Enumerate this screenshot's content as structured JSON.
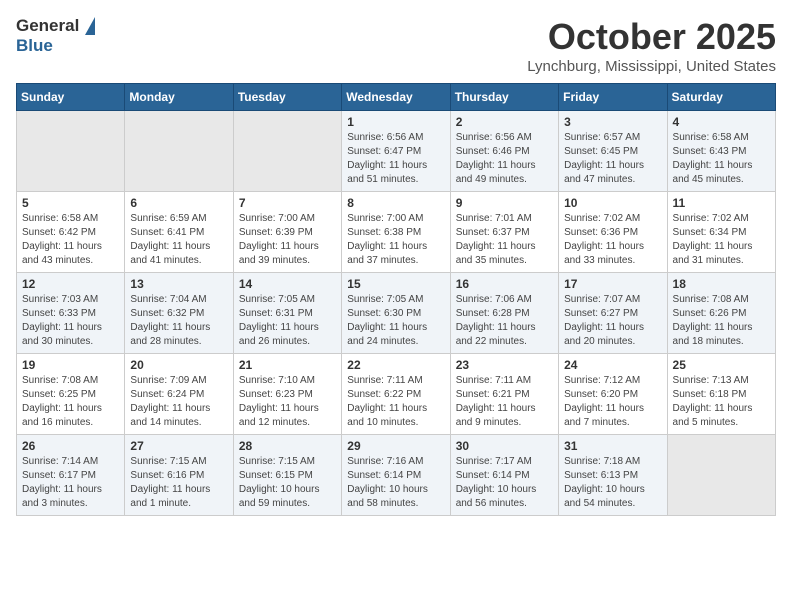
{
  "header": {
    "logo_general": "General",
    "logo_blue": "Blue",
    "month_title": "October 2025",
    "location": "Lynchburg, Mississippi, United States"
  },
  "days_of_week": [
    "Sunday",
    "Monday",
    "Tuesday",
    "Wednesday",
    "Thursday",
    "Friday",
    "Saturday"
  ],
  "weeks": [
    [
      {
        "day": "",
        "content": ""
      },
      {
        "day": "",
        "content": ""
      },
      {
        "day": "",
        "content": ""
      },
      {
        "day": "1",
        "content": "Sunrise: 6:56 AM\nSunset: 6:47 PM\nDaylight: 11 hours and 51 minutes."
      },
      {
        "day": "2",
        "content": "Sunrise: 6:56 AM\nSunset: 6:46 PM\nDaylight: 11 hours and 49 minutes."
      },
      {
        "day": "3",
        "content": "Sunrise: 6:57 AM\nSunset: 6:45 PM\nDaylight: 11 hours and 47 minutes."
      },
      {
        "day": "4",
        "content": "Sunrise: 6:58 AM\nSunset: 6:43 PM\nDaylight: 11 hours and 45 minutes."
      }
    ],
    [
      {
        "day": "5",
        "content": "Sunrise: 6:58 AM\nSunset: 6:42 PM\nDaylight: 11 hours and 43 minutes."
      },
      {
        "day": "6",
        "content": "Sunrise: 6:59 AM\nSunset: 6:41 PM\nDaylight: 11 hours and 41 minutes."
      },
      {
        "day": "7",
        "content": "Sunrise: 7:00 AM\nSunset: 6:39 PM\nDaylight: 11 hours and 39 minutes."
      },
      {
        "day": "8",
        "content": "Sunrise: 7:00 AM\nSunset: 6:38 PM\nDaylight: 11 hours and 37 minutes."
      },
      {
        "day": "9",
        "content": "Sunrise: 7:01 AM\nSunset: 6:37 PM\nDaylight: 11 hours and 35 minutes."
      },
      {
        "day": "10",
        "content": "Sunrise: 7:02 AM\nSunset: 6:36 PM\nDaylight: 11 hours and 33 minutes."
      },
      {
        "day": "11",
        "content": "Sunrise: 7:02 AM\nSunset: 6:34 PM\nDaylight: 11 hours and 31 minutes."
      }
    ],
    [
      {
        "day": "12",
        "content": "Sunrise: 7:03 AM\nSunset: 6:33 PM\nDaylight: 11 hours and 30 minutes."
      },
      {
        "day": "13",
        "content": "Sunrise: 7:04 AM\nSunset: 6:32 PM\nDaylight: 11 hours and 28 minutes."
      },
      {
        "day": "14",
        "content": "Sunrise: 7:05 AM\nSunset: 6:31 PM\nDaylight: 11 hours and 26 minutes."
      },
      {
        "day": "15",
        "content": "Sunrise: 7:05 AM\nSunset: 6:30 PM\nDaylight: 11 hours and 24 minutes."
      },
      {
        "day": "16",
        "content": "Sunrise: 7:06 AM\nSunset: 6:28 PM\nDaylight: 11 hours and 22 minutes."
      },
      {
        "day": "17",
        "content": "Sunrise: 7:07 AM\nSunset: 6:27 PM\nDaylight: 11 hours and 20 minutes."
      },
      {
        "day": "18",
        "content": "Sunrise: 7:08 AM\nSunset: 6:26 PM\nDaylight: 11 hours and 18 minutes."
      }
    ],
    [
      {
        "day": "19",
        "content": "Sunrise: 7:08 AM\nSunset: 6:25 PM\nDaylight: 11 hours and 16 minutes."
      },
      {
        "day": "20",
        "content": "Sunrise: 7:09 AM\nSunset: 6:24 PM\nDaylight: 11 hours and 14 minutes."
      },
      {
        "day": "21",
        "content": "Sunrise: 7:10 AM\nSunset: 6:23 PM\nDaylight: 11 hours and 12 minutes."
      },
      {
        "day": "22",
        "content": "Sunrise: 7:11 AM\nSunset: 6:22 PM\nDaylight: 11 hours and 10 minutes."
      },
      {
        "day": "23",
        "content": "Sunrise: 7:11 AM\nSunset: 6:21 PM\nDaylight: 11 hours and 9 minutes."
      },
      {
        "day": "24",
        "content": "Sunrise: 7:12 AM\nSunset: 6:20 PM\nDaylight: 11 hours and 7 minutes."
      },
      {
        "day": "25",
        "content": "Sunrise: 7:13 AM\nSunset: 6:18 PM\nDaylight: 11 hours and 5 minutes."
      }
    ],
    [
      {
        "day": "26",
        "content": "Sunrise: 7:14 AM\nSunset: 6:17 PM\nDaylight: 11 hours and 3 minutes."
      },
      {
        "day": "27",
        "content": "Sunrise: 7:15 AM\nSunset: 6:16 PM\nDaylight: 11 hours and 1 minute."
      },
      {
        "day": "28",
        "content": "Sunrise: 7:15 AM\nSunset: 6:15 PM\nDaylight: 10 hours and 59 minutes."
      },
      {
        "day": "29",
        "content": "Sunrise: 7:16 AM\nSunset: 6:14 PM\nDaylight: 10 hours and 58 minutes."
      },
      {
        "day": "30",
        "content": "Sunrise: 7:17 AM\nSunset: 6:14 PM\nDaylight: 10 hours and 56 minutes."
      },
      {
        "day": "31",
        "content": "Sunrise: 7:18 AM\nSunset: 6:13 PM\nDaylight: 10 hours and 54 minutes."
      },
      {
        "day": "",
        "content": ""
      }
    ]
  ]
}
